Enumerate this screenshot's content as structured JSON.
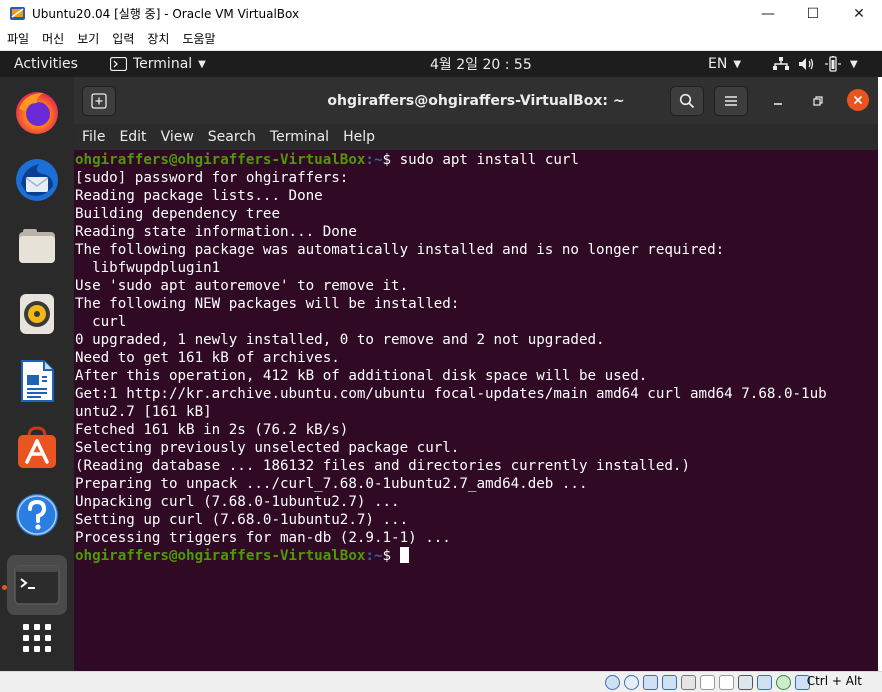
{
  "host_window": {
    "title": "Ubuntu20.04 [실행 중] - Oracle VM VirtualBox",
    "menu": [
      "파일",
      "머신",
      "보기",
      "입력",
      "장치",
      "도움말"
    ],
    "controls": {
      "minimize": "—",
      "maximize": "☐",
      "close": "✕"
    },
    "host_key": "Ctrl + Alt"
  },
  "topbar": {
    "activities": "Activities",
    "app_name": "Terminal",
    "clock": "4월 2일  20 : 55",
    "input_method": "EN"
  },
  "dock": {
    "items": [
      "firefox-icon",
      "thunderbird-icon",
      "files-icon",
      "rhythmbox-icon",
      "libreoffice-writer-icon",
      "ubuntu-software-icon",
      "help-icon",
      "terminal-icon"
    ],
    "show_apps": "show-applications-icon"
  },
  "terminal": {
    "title": "ohgiraffers@ohgiraffers-VirtualBox: ~",
    "menu": [
      "File",
      "Edit",
      "View",
      "Search",
      "Terminal",
      "Help"
    ],
    "prompt_user": "ohgiraffers@ohgiraffers-VirtualBox",
    "prompt_path": ":~",
    "prompt_symbol": "$ ",
    "command": "sudo apt install curl",
    "output": [
      "[sudo] password for ohgiraffers: ",
      "Reading package lists... Done",
      "Building dependency tree",
      "Reading state information... Done",
      "The following package was automatically installed and is no longer required:",
      "  libfwupdplugin1",
      "Use 'sudo apt autoremove' to remove it.",
      "The following NEW packages will be installed:",
      "  curl",
      "0 upgraded, 1 newly installed, 0 to remove and 2 not upgraded.",
      "Need to get 161 kB of archives.",
      "After this operation, 412 kB of additional disk space will be used.",
      "Get:1 http://kr.archive.ubuntu.com/ubuntu focal-updates/main amd64 curl amd64 7.68.0-1ub",
      "untu2.7 [161 kB]",
      "Fetched 161 kB in 2s (76.2 kB/s)",
      "Selecting previously unselected package curl.",
      "(Reading database ... 186132 files and directories currently installed.)",
      "Preparing to unpack .../curl_7.68.0-1ubuntu2.7_amd64.deb ...",
      "Unpacking curl (7.68.0-1ubuntu2.7) ...",
      "Setting up curl (7.68.0-1ubuntu2.7) ...",
      "Processing triggers for man-db (2.9.1-1) ..."
    ]
  },
  "colors": {
    "terminal_bg": "#300a24",
    "prompt_user": "#4e9a06",
    "prompt_path": "#3465a4",
    "ubuntu_orange": "#e95420"
  }
}
